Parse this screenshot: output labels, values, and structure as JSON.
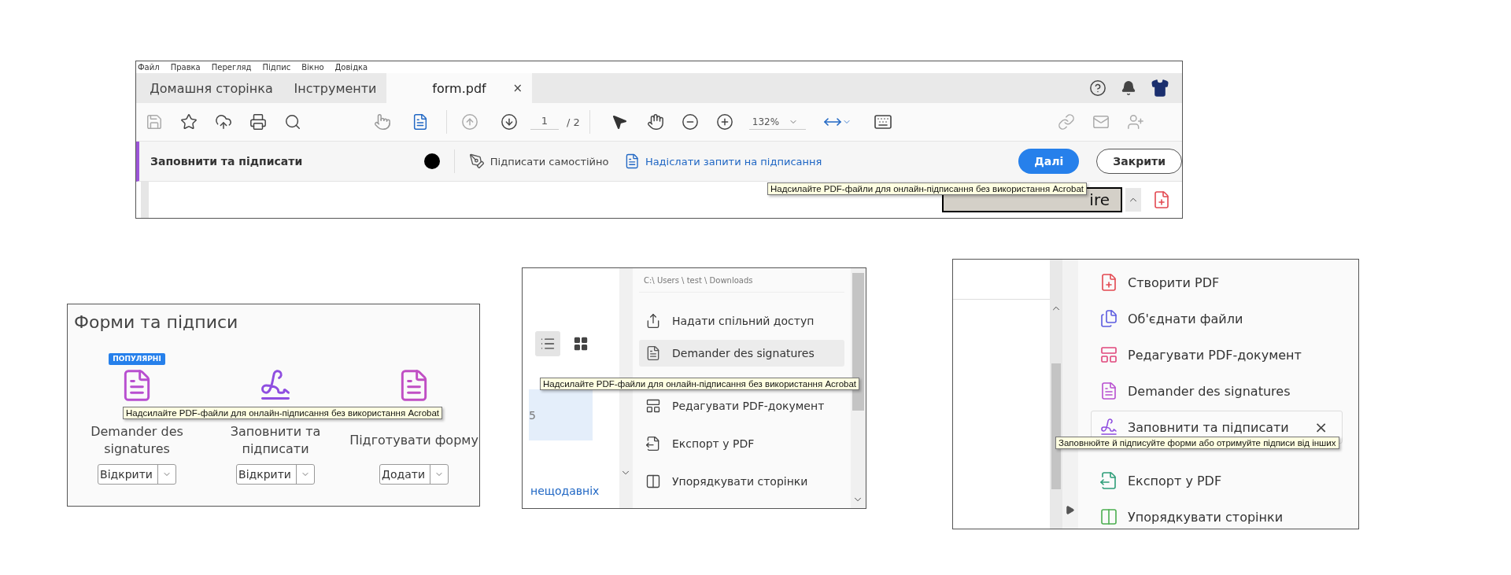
{
  "editor": {
    "menu": [
      "Файл",
      "Правка",
      "Перегляд",
      "Підпис",
      "Вікно",
      "Довідка"
    ],
    "tabs": [
      {
        "label": "Домашня сторінка",
        "selected": false
      },
      {
        "label": "Інструменти",
        "selected": false
      },
      {
        "label": "form.pdf",
        "selected": true
      }
    ],
    "tab_close": "×",
    "page_number": "1",
    "page_total": "/ 2",
    "zoom": "132%",
    "fill_sign": {
      "title": "Заповнити та підписати",
      "sign_self": "Підписати самостійно",
      "request": "Надіслати запити на підписання",
      "next": "Далі",
      "close": "Закрити"
    },
    "document_button": "ire",
    "tooltip": "Надсилайте PDF-файли для онлайн-підписання без використання Acrobat"
  },
  "forms_panel": {
    "title": "Форми та підписи",
    "tools": [
      {
        "kind": "request",
        "name": "Demander des signatures",
        "action": "Відкрити",
        "badge": "ПОПУЛЯРНІ"
      },
      {
        "kind": "fill_sign",
        "name": "Заповнити та підписати",
        "action": "Відкрити"
      },
      {
        "kind": "prepare_form",
        "name": "Підготувати форму",
        "action": "Додати"
      }
    ],
    "tooltip": "Надсилайте PDF-файли для онлайн-підписання без використання Acrobat"
  },
  "files_panel": {
    "views": [
      {
        "kind": "list",
        "selected": true
      },
      {
        "kind": "grid",
        "selected": false
      }
    ],
    "recent_item": "5",
    "recent_link": "нещодавніх",
    "path": "C:\\ Users \\ test \\ Downloads",
    "menu": [
      {
        "kind": "share",
        "label": "Надати спільний доступ",
        "selected": false
      },
      {
        "kind": "request",
        "label": "Demander des signatures",
        "selected": true
      },
      {
        "kind": "edit",
        "label": "Редагувати PDF-документ",
        "selected": false
      },
      {
        "kind": "export",
        "label": "Експорт у PDF",
        "selected": false
      },
      {
        "kind": "organize",
        "label": "Упорядкувати сторінки",
        "selected": false
      }
    ],
    "tooltip": "Надсилайте PDF-файли для онлайн-підписання без використання Acrobat"
  },
  "tools_panel": {
    "menu": [
      {
        "kind": "create",
        "label": "Створити PDF",
        "selected": false
      },
      {
        "kind": "combine",
        "label": "Об'єднати файли",
        "selected": false
      },
      {
        "kind": "edit",
        "label": "Редагувати PDF-документ",
        "selected": false
      },
      {
        "kind": "request",
        "label": "Demander des signatures",
        "selected": false
      },
      {
        "kind": "fill_sign",
        "label": "Заповнити та підписати",
        "selected": true
      },
      {
        "kind": "export",
        "label": "Експорт у PDF",
        "selected": false
      },
      {
        "kind": "organize",
        "label": "Упорядкувати сторінки",
        "selected": false
      }
    ],
    "close": "×",
    "tooltip": "Заповнюйте й підписуйте форми або отримуйте підписи від інших"
  }
}
